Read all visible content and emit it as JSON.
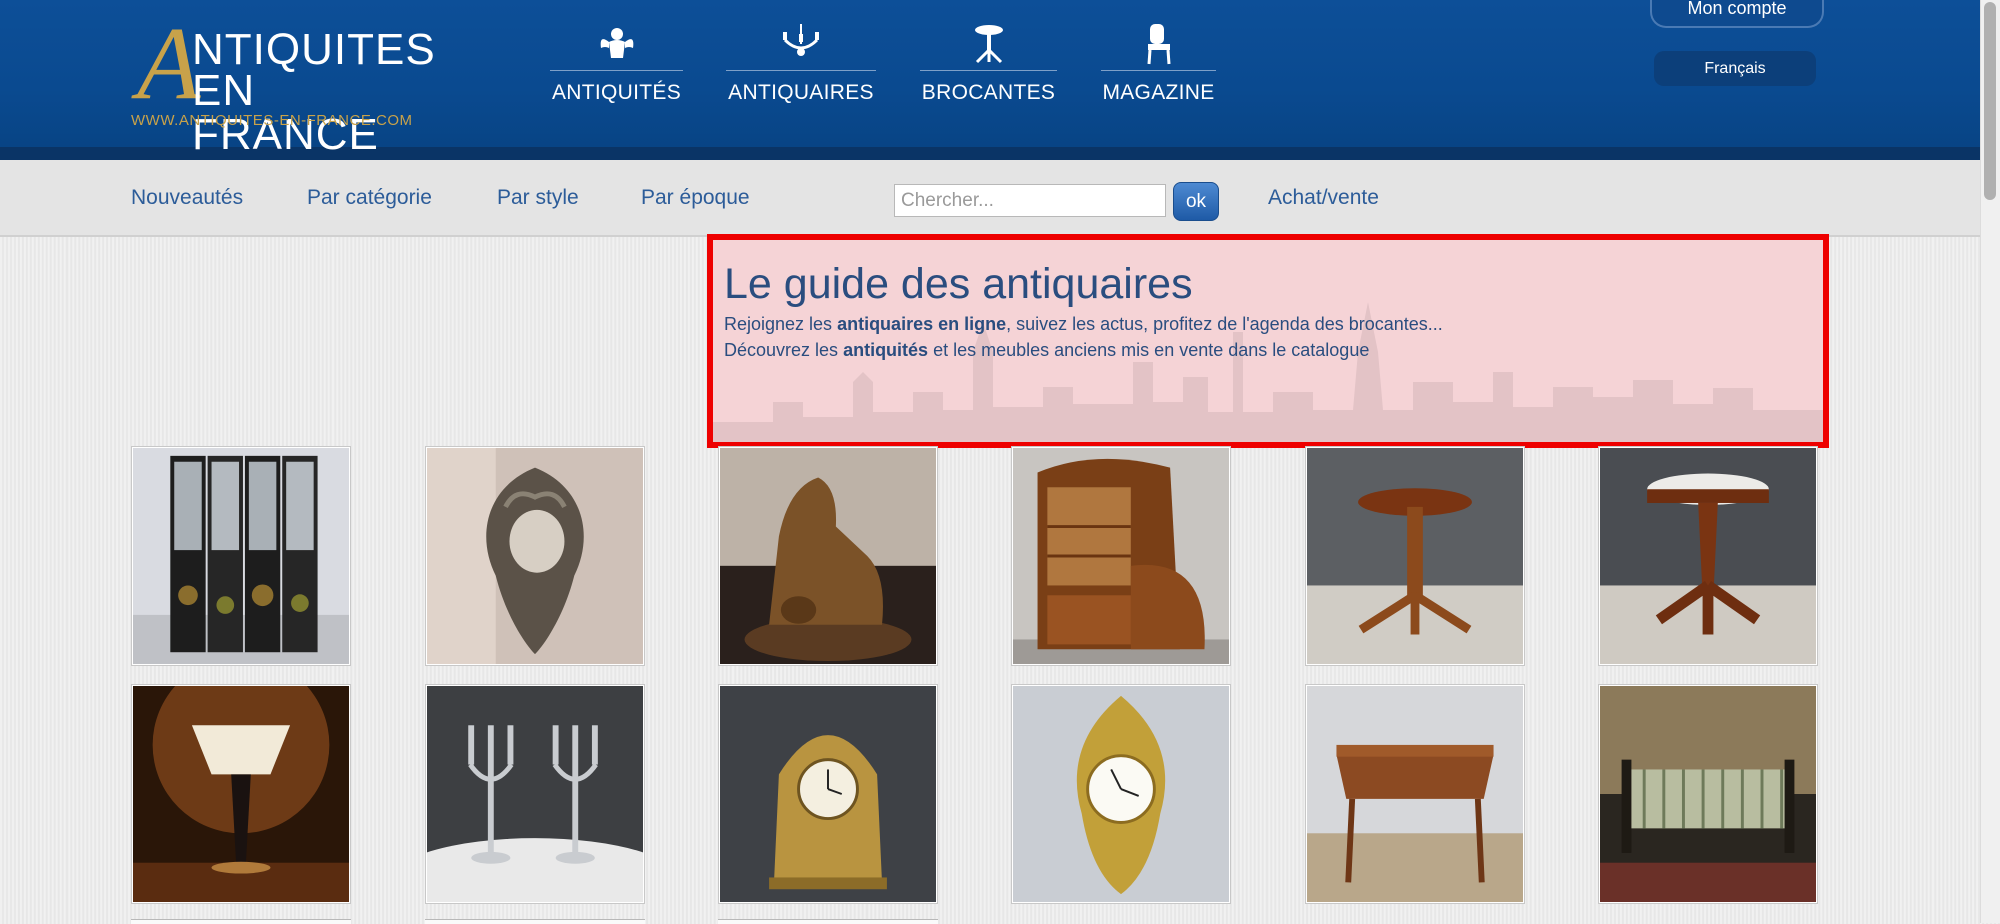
{
  "header": {
    "logo": {
      "line1": "NTIQUITES",
      "big_letter": "A",
      "line2": "EN FRANCE",
      "url": "WWW.ANTIQUITES-EN-FRANCE.COM"
    },
    "nav": [
      {
        "label": "ANTIQUITÉS",
        "icon": "cherub-icon"
      },
      {
        "label": "ANTIQUAIRES",
        "icon": "chandelier-icon"
      },
      {
        "label": "BROCANTES",
        "icon": "pedestal-table-icon"
      },
      {
        "label": "MAGAZINE",
        "icon": "chair-icon"
      }
    ],
    "account_label": "Mon compte",
    "language_label": "Français"
  },
  "subnav": {
    "links": [
      "Nouveautés",
      "Par catégorie",
      "Par style",
      "Par époque"
    ],
    "search_placeholder": "Chercher...",
    "ok_label": "ok",
    "buy_sell_label": "Achat/vente"
  },
  "guide": {
    "title": "Le guide des antiquaires",
    "line1_pre": "Rejoignez les ",
    "line1_bold": "antiquaires en ligne",
    "line1_post": ", suivez les actus, profitez de l'agenda des brocantes...",
    "line2_pre": "Découvrez les ",
    "line2_bold": "antiquités",
    "line2_post": " et les meubles anciens mis en vente dans le catalogue"
  },
  "products": [
    {
      "name": "folding-screen-image"
    },
    {
      "name": "rococo-cartel-image"
    },
    {
      "name": "bronze-lion-sculpture-image"
    },
    {
      "name": "art-nouveau-cabinet-image"
    },
    {
      "name": "pedestal-table-image"
    },
    {
      "name": "marble-top-table-image"
    },
    {
      "name": "table-lamp-image"
    },
    {
      "name": "silver-candelabra-image"
    },
    {
      "name": "gilt-mantel-clock-image"
    },
    {
      "name": "gilt-wall-clock-image"
    },
    {
      "name": "drop-leaf-table-image"
    },
    {
      "name": "striped-settee-image"
    }
  ]
}
